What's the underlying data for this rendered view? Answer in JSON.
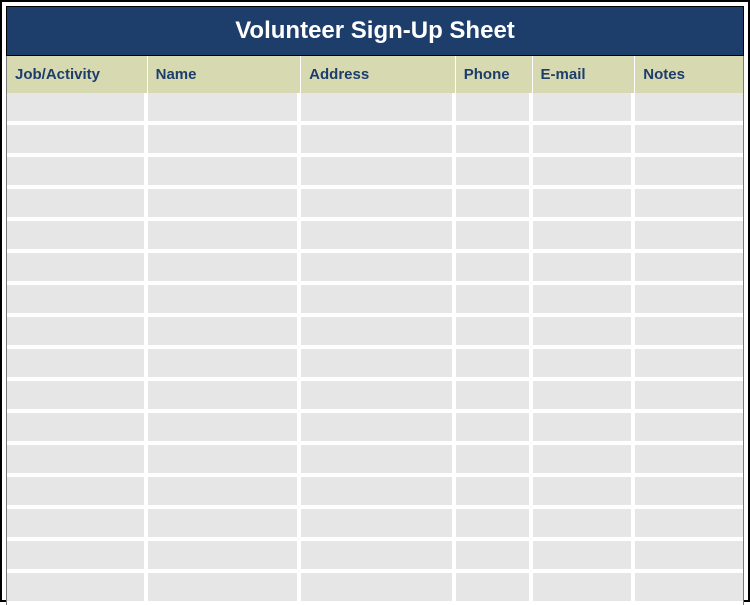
{
  "title": "Volunteer Sign-Up Sheet",
  "columns": [
    {
      "label": "Job/Activity"
    },
    {
      "label": "Name"
    },
    {
      "label": "Address"
    },
    {
      "label": "Phone"
    },
    {
      "label": "E-mail"
    },
    {
      "label": "Notes"
    }
  ],
  "rows": [
    {
      "job_activity": "",
      "name": "",
      "address": "",
      "phone": "",
      "email": "",
      "notes": ""
    },
    {
      "job_activity": "",
      "name": "",
      "address": "",
      "phone": "",
      "email": "",
      "notes": ""
    },
    {
      "job_activity": "",
      "name": "",
      "address": "",
      "phone": "",
      "email": "",
      "notes": ""
    },
    {
      "job_activity": "",
      "name": "",
      "address": "",
      "phone": "",
      "email": "",
      "notes": ""
    },
    {
      "job_activity": "",
      "name": "",
      "address": "",
      "phone": "",
      "email": "",
      "notes": ""
    },
    {
      "job_activity": "",
      "name": "",
      "address": "",
      "phone": "",
      "email": "",
      "notes": ""
    },
    {
      "job_activity": "",
      "name": "",
      "address": "",
      "phone": "",
      "email": "",
      "notes": ""
    },
    {
      "job_activity": "",
      "name": "",
      "address": "",
      "phone": "",
      "email": "",
      "notes": ""
    },
    {
      "job_activity": "",
      "name": "",
      "address": "",
      "phone": "",
      "email": "",
      "notes": ""
    },
    {
      "job_activity": "",
      "name": "",
      "address": "",
      "phone": "",
      "email": "",
      "notes": ""
    },
    {
      "job_activity": "",
      "name": "",
      "address": "",
      "phone": "",
      "email": "",
      "notes": ""
    },
    {
      "job_activity": "",
      "name": "",
      "address": "",
      "phone": "",
      "email": "",
      "notes": ""
    },
    {
      "job_activity": "",
      "name": "",
      "address": "",
      "phone": "",
      "email": "",
      "notes": ""
    },
    {
      "job_activity": "",
      "name": "",
      "address": "",
      "phone": "",
      "email": "",
      "notes": ""
    },
    {
      "job_activity": "",
      "name": "",
      "address": "",
      "phone": "",
      "email": "",
      "notes": ""
    },
    {
      "job_activity": "",
      "name": "",
      "address": "",
      "phone": "",
      "email": "",
      "notes": ""
    }
  ]
}
